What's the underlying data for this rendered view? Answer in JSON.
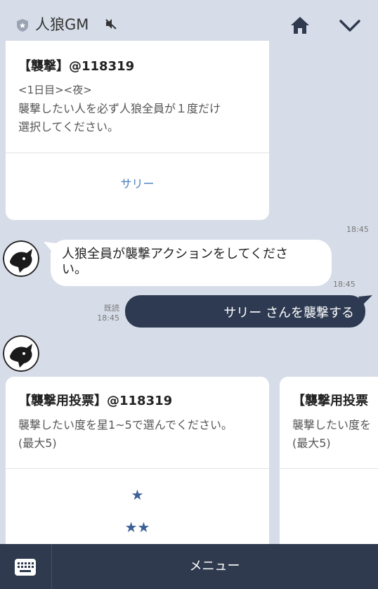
{
  "header": {
    "title": "人狼GM",
    "icons": [
      "shield-icon",
      "mute-icon",
      "home-icon",
      "chevron-down-icon"
    ]
  },
  "attack_card": {
    "title": "【襲撃】@118319",
    "line1": "<1日目><夜>",
    "line2": "襲撃したい人を必ず人狼全員が１度だけ",
    "line3": "選択してください。",
    "action": "サリー",
    "time": "18:45"
  },
  "message_received": {
    "text_line1": "人狼全員が襲撃アクションをしてくださ",
    "text_line2": "い。",
    "time": "18:45"
  },
  "message_sent": {
    "read_label": "既読",
    "time": "18:45",
    "text": "サリー さんを襲撃する"
  },
  "vote_card_1": {
    "title": "【襲撃用投票】@118319",
    "line1": "襲撃したい度を星1~5で選んでください。",
    "line2": "(最大5)",
    "options": [
      "★",
      "★★"
    ]
  },
  "vote_card_2": {
    "title": "【襲撃用投票",
    "line1": "襲撃したい度を",
    "line2": "(最大5)"
  },
  "footer": {
    "menu_label": "メニュー"
  }
}
